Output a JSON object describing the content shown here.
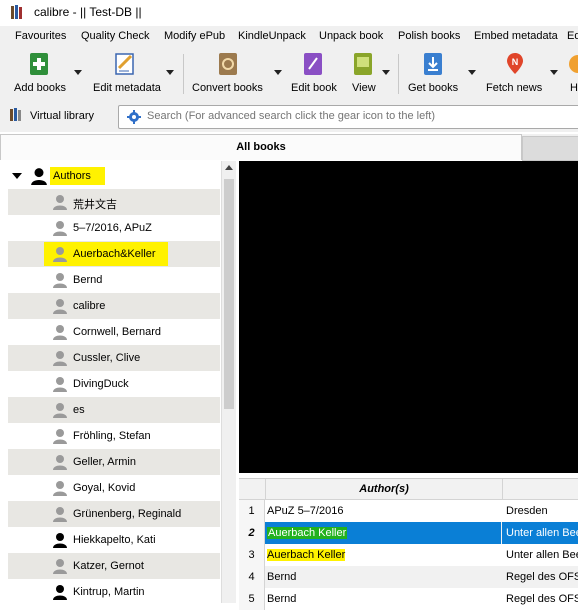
{
  "window": {
    "title": "calibre - || Test-DB ||",
    "icon": "calibre-books-icon"
  },
  "menu": [
    "Favourites",
    "Quality Check",
    "Modify ePub",
    "KindleUnpack",
    "Unpack book",
    "Polish books",
    "Embed metadata",
    "Ed"
  ],
  "toolbar": {
    "add_books": "Add books",
    "edit_metadata": "Edit metadata",
    "convert_books": "Convert books",
    "edit_book": "Edit book",
    "view": "View",
    "get_books": "Get books",
    "fetch_news": "Fetch news",
    "more": "H"
  },
  "search": {
    "virtual_library": "Virtual library",
    "placeholder": "Search (For advanced search click the gear icon to the left)"
  },
  "tabs": {
    "all_books": "All books"
  },
  "tag_browser": {
    "category": "Authors",
    "authors": [
      "荒井文吉",
      "5–7/2016, APuZ",
      "Auerbach&Keller",
      "Bernd",
      "calibre",
      "Cornwell, Bernard",
      "Cussler, Clive",
      "DivingDuck",
      "es",
      "Fröhling, Stefan",
      "Geller, Armin",
      "Goyal, Kovid",
      "Grünenberg, Reginald",
      "Hiekkapelto, Kati",
      "Katzer, Gernot",
      "Kintrup, Martin"
    ]
  },
  "table": {
    "author_header": "Author(s)",
    "rows": [
      {
        "num": "1",
        "author": "APuZ 5–7/2016",
        "title": "Dresden"
      },
      {
        "num": "2",
        "author": "Auerbach Keller",
        "title": "Unter allen Bee"
      },
      {
        "num": "3",
        "author": "Auerbach Keller",
        "title": "Unter allen Bee"
      },
      {
        "num": "4",
        "author": "Bernd",
        "title": "Regel des OFS"
      },
      {
        "num": "5",
        "author": "Bernd",
        "title": "Regel des OFS"
      }
    ]
  },
  "colors": {
    "selection": "#0a7fd6",
    "highlight_yellow": "#fff200",
    "highlight_green": "#22b11e",
    "tag_alt_row": "#e8e7e3"
  }
}
